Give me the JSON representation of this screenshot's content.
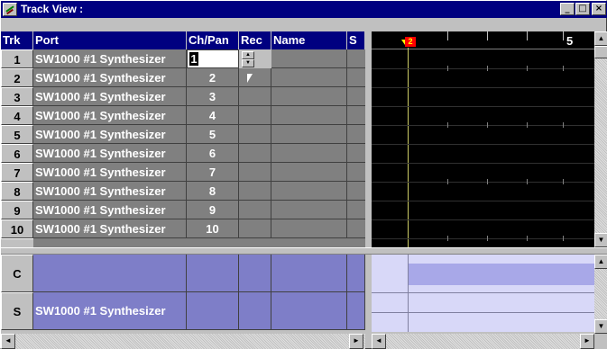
{
  "window": {
    "title": "Track View :",
    "min_label": "_",
    "max_label": "□",
    "close_label": "×"
  },
  "table": {
    "headers": {
      "trk": "Trk",
      "port": "Port",
      "chpan": "Ch/Pan",
      "rec": "Rec",
      "name": "Name",
      "solo": "S"
    },
    "rows": [
      {
        "num": "1",
        "port": "SW1000 #1 Synthesizer",
        "ch": "1"
      },
      {
        "num": "2",
        "port": "SW1000 #1 Synthesizer",
        "ch": "2"
      },
      {
        "num": "3",
        "port": "SW1000 #1 Synthesizer",
        "ch": "3"
      },
      {
        "num": "4",
        "port": "SW1000 #1 Synthesizer",
        "ch": "4"
      },
      {
        "num": "5",
        "port": "SW1000 #1 Synthesizer",
        "ch": "5"
      },
      {
        "num": "6",
        "port": "SW1000 #1 Synthesizer",
        "ch": "6"
      },
      {
        "num": "7",
        "port": "SW1000 #1 Synthesizer",
        "ch": "7"
      },
      {
        "num": "8",
        "port": "SW1000 #1 Synthesizer",
        "ch": "8"
      },
      {
        "num": "9",
        "port": "SW1000 #1 Synthesizer",
        "ch": "9"
      },
      {
        "num": "10",
        "port": "SW1000 #1 Synthesizer",
        "ch": "10"
      }
    ]
  },
  "timeline": {
    "marker_label": "2",
    "bar_label": "5"
  },
  "bottom": {
    "rows": [
      {
        "label": "C",
        "port": ""
      },
      {
        "label": "S",
        "port": "SW1000 #1 Synthesizer"
      }
    ]
  },
  "scroll": {
    "up": "▲",
    "down": "▼",
    "left": "◄",
    "right": "►"
  },
  "colors": {
    "title_bar": "#000080",
    "track_cell": "#808080",
    "bottom_cell": "#7e7ec8",
    "timeline_bg": "#000000"
  }
}
